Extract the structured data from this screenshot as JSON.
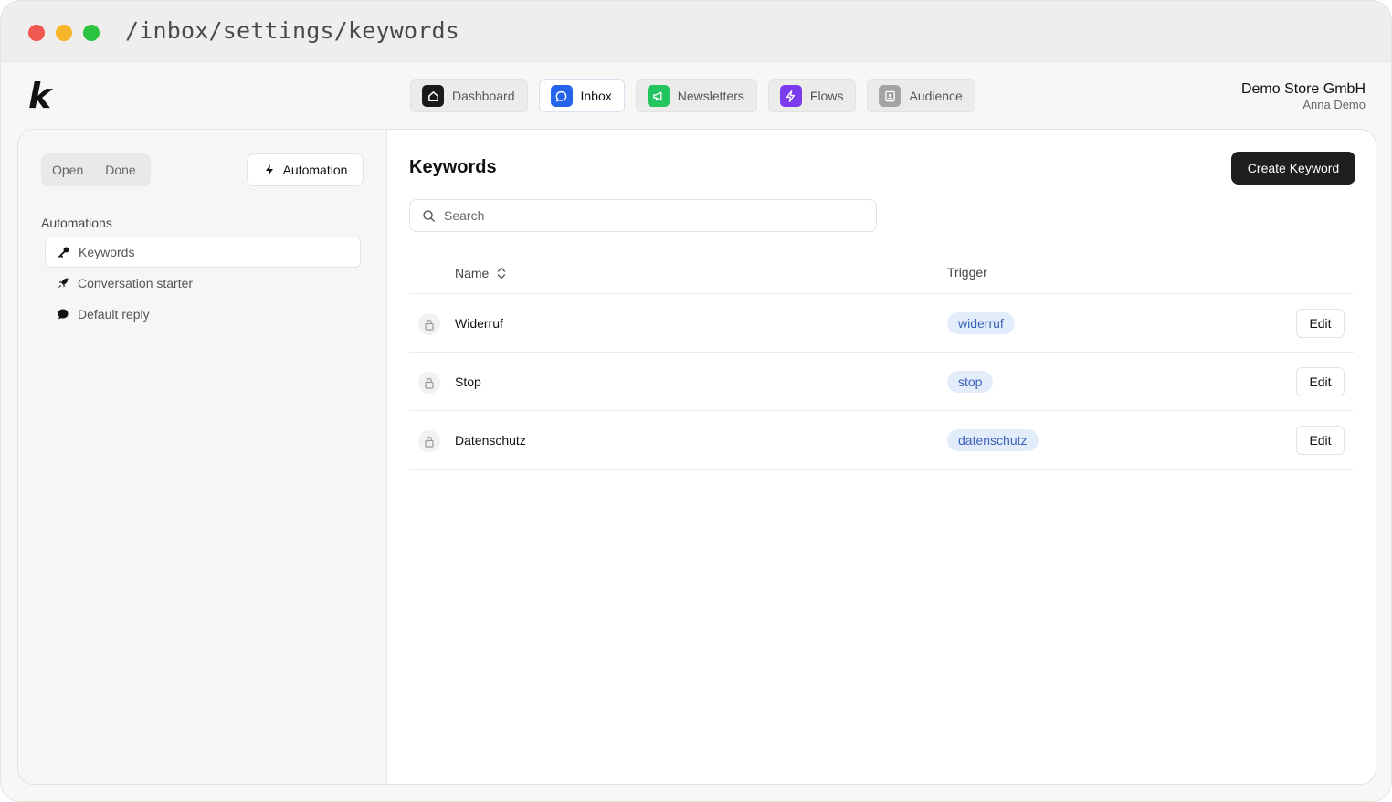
{
  "window": {
    "url": "/inbox/settings/keywords"
  },
  "app": {
    "logo_text": "k",
    "nav": [
      {
        "label": "Dashboard",
        "icon": "dashboard-icon",
        "color": "#1a1a1a"
      },
      {
        "label": "Inbox",
        "icon": "inbox-icon",
        "color": "#2563eb",
        "active": true
      },
      {
        "label": "Newsletters",
        "icon": "megaphone-icon",
        "color": "#22c55e"
      },
      {
        "label": "Flows",
        "icon": "lightning-icon",
        "color": "#7c3aed"
      },
      {
        "label": "Audience",
        "icon": "contact-icon",
        "color": "#a3a3a3"
      }
    ],
    "account": {
      "company": "Demo Store GmbH",
      "user": "Anna Demo"
    }
  },
  "sidebar": {
    "segment": [
      "Open",
      "Done"
    ],
    "automation_button": "Automation",
    "heading": "Automations",
    "items": [
      {
        "label": "Keywords",
        "icon": "key-icon",
        "active": true
      },
      {
        "label": "Conversation starter",
        "icon": "rocket-icon"
      },
      {
        "label": "Default reply",
        "icon": "chat-bubble-icon"
      }
    ]
  },
  "main": {
    "title": "Keywords",
    "create_button": "Create Keyword",
    "search_placeholder": "Search",
    "columns": {
      "name": "Name",
      "trigger": "Trigger"
    },
    "rows": [
      {
        "name": "Widerruf",
        "trigger": "widerruf",
        "action": "Edit"
      },
      {
        "name": "Stop",
        "trigger": "stop",
        "action": "Edit"
      },
      {
        "name": "Datenschutz",
        "trigger": "datenschutz",
        "action": "Edit"
      }
    ],
    "badge_color": "#e3ecfb",
    "badge_text_color": "#3a62b8"
  }
}
